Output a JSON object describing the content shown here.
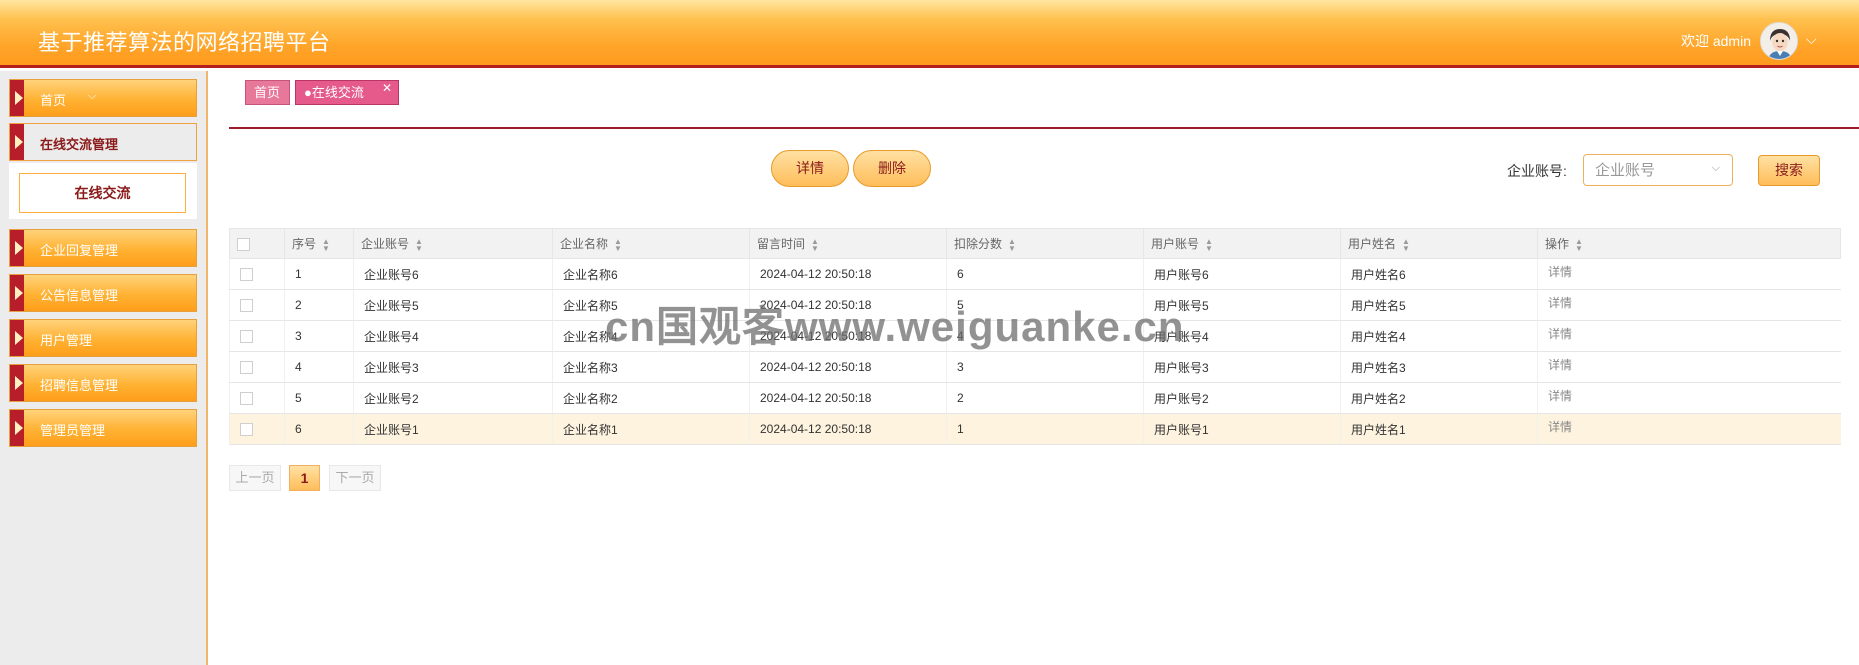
{
  "header": {
    "title": "基于推荐算法的网络招聘平台",
    "welcome": "欢迎 admin",
    "caret": "⌵"
  },
  "sidebar": {
    "items": [
      {
        "label": "首页",
        "chevron": "⌵"
      },
      {
        "label": "在线交流管理",
        "sub": [
          {
            "label": "在线交流"
          }
        ]
      },
      {
        "label": "企业回复管理"
      },
      {
        "label": "公告信息管理"
      },
      {
        "label": "用户管理"
      },
      {
        "label": "招聘信息管理"
      },
      {
        "label": "管理员管理"
      }
    ]
  },
  "tabs": {
    "home": "首页",
    "active": "●在线交流",
    "close": "✕"
  },
  "actions": {
    "detail": "详情",
    "delete": "删除",
    "search_label": "企业账号:",
    "search_placeholder": "企业账号",
    "search_button": "搜索"
  },
  "table": {
    "columns": [
      "序号",
      "企业账号",
      "企业名称",
      "留言时间",
      "扣除分数",
      "用户账号",
      "用户姓名",
      "操作"
    ],
    "rows": [
      {
        "index": "1",
        "company_account": "企业账号6",
        "company_name": "企业名称6",
        "time": "2024-04-12 20:50:18",
        "score": "6",
        "user_account": "用户账号6",
        "user_name": "用户姓名6",
        "action": "详情"
      },
      {
        "index": "2",
        "company_account": "企业账号5",
        "company_name": "企业名称5",
        "time": "2024-04-12 20:50:18",
        "score": "5",
        "user_account": "用户账号5",
        "user_name": "用户姓名5",
        "action": "详情"
      },
      {
        "index": "3",
        "company_account": "企业账号4",
        "company_name": "企业名称4",
        "time": "2024-04-12 20:50:18",
        "score": "4",
        "user_account": "用户账号4",
        "user_name": "用户姓名4",
        "action": "详情"
      },
      {
        "index": "4",
        "company_account": "企业账号3",
        "company_name": "企业名称3",
        "time": "2024-04-12 20:50:18",
        "score": "3",
        "user_account": "用户账号3",
        "user_name": "用户姓名3",
        "action": "详情"
      },
      {
        "index": "5",
        "company_account": "企业账号2",
        "company_name": "企业名称2",
        "time": "2024-04-12 20:50:18",
        "score": "2",
        "user_account": "用户账号2",
        "user_name": "用户姓名2",
        "action": "详情"
      },
      {
        "index": "6",
        "company_account": "企业账号1",
        "company_name": "企业名称1",
        "time": "2024-04-12 20:50:18",
        "score": "1",
        "user_account": "用户账号1",
        "user_name": "用户姓名1",
        "action": "详情"
      }
    ]
  },
  "pager": {
    "prev": "上一页",
    "current": "1",
    "next": "下一页"
  },
  "watermark": "cn国观客www.weiguanke.cn",
  "colors": {
    "header_orange": "#ffa52a",
    "accent_red": "#b41e1e",
    "tab_pink": "#e55a8a",
    "highlight_row": "#fdf3df"
  }
}
